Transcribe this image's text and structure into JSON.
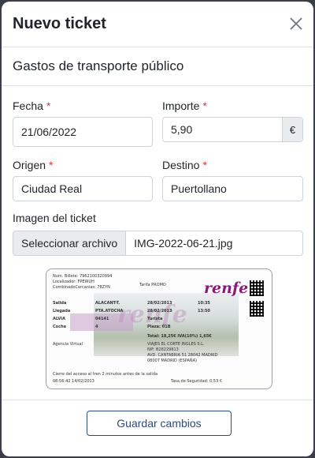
{
  "modal": {
    "title": "Nuevo ticket",
    "section_title": "Gastos de transporte público"
  },
  "form": {
    "fecha": {
      "label": "Fecha",
      "value": "21/06/2022"
    },
    "importe": {
      "label": "Importe",
      "value": "5,90",
      "currency": "€"
    },
    "origen": {
      "label": "Origen",
      "value": "Ciudad Real"
    },
    "destino": {
      "label": "Destino",
      "value": "Puertollano"
    },
    "required_mark": "*",
    "imagen": {
      "label": "Imagen del ticket",
      "button": "Seleccionar archivo",
      "file_name": "IMG-2022-06-21.jpg"
    }
  },
  "ticket_image": {
    "billete": "Num. Billete: 7962100320994",
    "localizador": "Localizador: FPEWUH",
    "combinado": "CombinadoCercanias: 78ZYN",
    "tarifa": "Tarifa PROMO",
    "logo": "renfe",
    "salida_label": "Salida",
    "salida_station": "ALACANT-T.",
    "salida_date": "28/02/2013",
    "salida_time": "10:35",
    "llegada_label": "Llegada",
    "llegada_station": "PTA.ATOCHA",
    "llegada_date": "28/02/2013",
    "llegada_time": "13:50",
    "tren_label": "ALVIA",
    "tren_num": "04141",
    "clase": "Turista",
    "coche_label": "Coche",
    "coche_num": "4",
    "plaza": "Plaza: 01B",
    "agencia": "Agencia Virtual",
    "total": "Total: 18,25€ IVA(10%) 1,65€",
    "empresa_1": "VIAJES EL CORTE INGLES S.L.",
    "empresa_2": "NIF: B28229813",
    "empresa_3": "AVD. CANTABRIA 51 28042 MADRID",
    "empresa_4": "08007 MADRID (ESPAÑA)",
    "cierre": "Cierre del acceso al tren 2 minutos antes de la salida",
    "timestamp": "08:56:42 14/02/2013",
    "footer": "Tasa de Seguridad: 0,53 €"
  },
  "footer": {
    "save_label": "Guardar cambios"
  }
}
